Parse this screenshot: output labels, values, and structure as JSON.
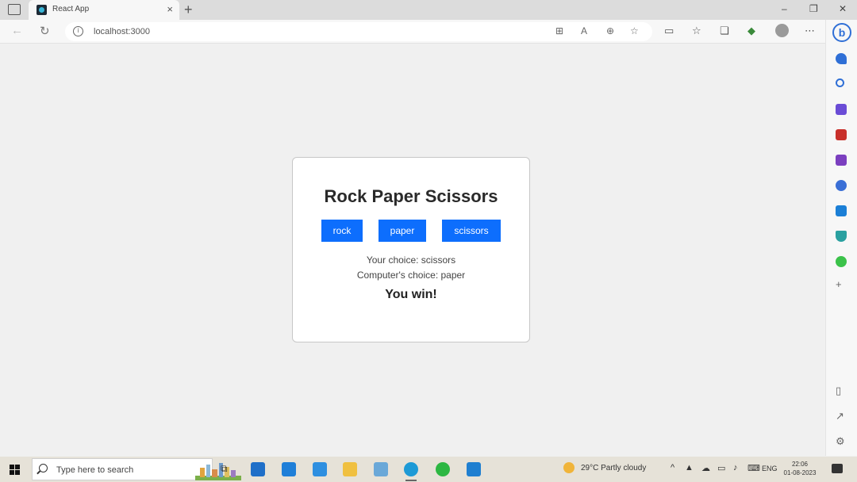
{
  "browser": {
    "tab_title": "React App",
    "url": "localhost:3000",
    "sidebar_logo": "b"
  },
  "game": {
    "title": "Rock Paper Scissors",
    "buttons": [
      "rock",
      "paper",
      "scissors"
    ],
    "your_choice_label": "Your choice: scissors",
    "computer_choice_label": "Computer's choice: paper",
    "result": "You win!"
  },
  "taskbar": {
    "search_placeholder": "Type here to search",
    "weather": "29°C  Partly cloudy",
    "lang": "ENG",
    "time": "22:06",
    "date": "01-08-2023"
  },
  "colors": {
    "button": "#0d6efd",
    "page_bg": "#f0f0f0",
    "edge_accent": "#2f6fd6"
  }
}
